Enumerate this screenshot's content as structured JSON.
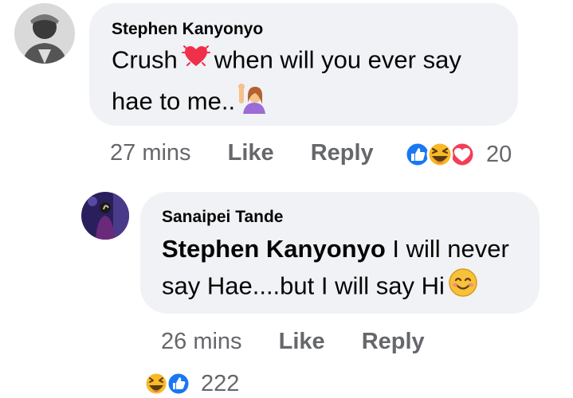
{
  "comments": [
    {
      "author": "Stephen Kanyonyo",
      "text_line1_before": "Crush",
      "text_line1_after": "when will you ever say",
      "text_line2": "hae to me..",
      "emoji_1": "heart-icon",
      "emoji_2": "woman-raising-hand-icon",
      "time": "27 mins",
      "like_label": "Like",
      "reply_label": "Reply",
      "reaction_icons": [
        "like-icon",
        "haha-icon",
        "love-icon"
      ],
      "reaction_count": "20"
    },
    {
      "author": "Sanaipei Tande",
      "mention": "Stephen Kanyonyo",
      "text_line1_after": "I will never",
      "text_line2": "say Hae....but I will say Hi",
      "emoji_1": "smiling-face-icon",
      "time": "26 mins",
      "like_label": "Like",
      "reply_label": "Reply",
      "reaction_icons": [
        "haha-icon",
        "like-icon"
      ],
      "reaction_count": "222"
    }
  ],
  "colors": {
    "bubble": "#f0f2f5",
    "meta_text": "#65676b",
    "like_blue": "#1877f2",
    "love_red": "#f33e58",
    "haha_yellow": "#f7b928"
  }
}
